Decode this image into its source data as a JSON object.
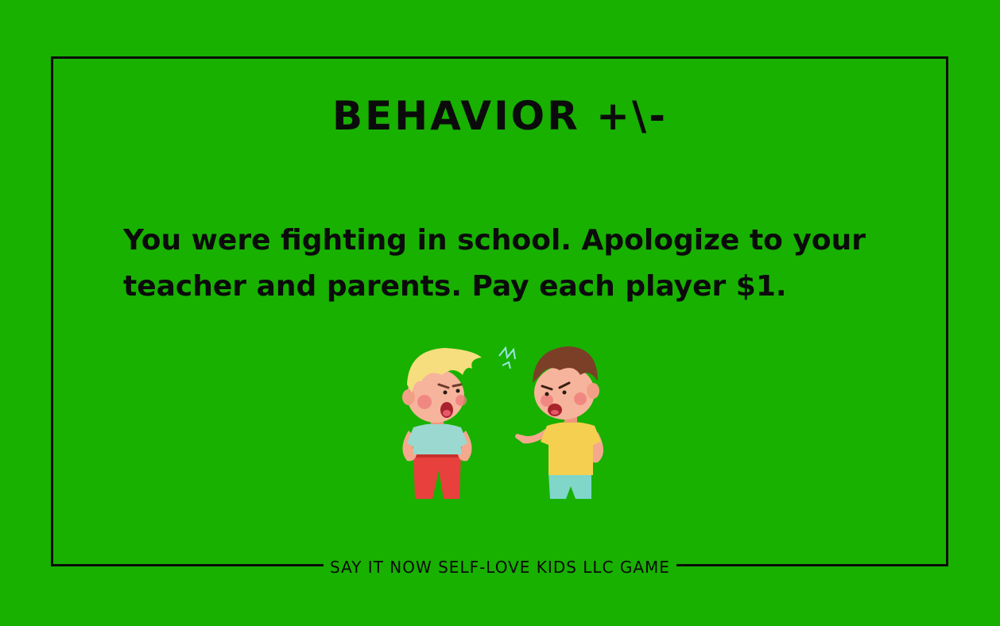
{
  "card": {
    "title": "BEHAVIOR +\\-",
    "text": "You were fighting in school.  Apologize to your\nteacher and parents. Pay each player $1.",
    "footer": "SAY IT NOW SELF-LOVE KIDS LLC GAME",
    "illustration": "two-boys-arguing-illustration"
  },
  "colors": {
    "background": "#18b100",
    "border": "#0b0b0b",
    "text": "#0b0b0b"
  }
}
